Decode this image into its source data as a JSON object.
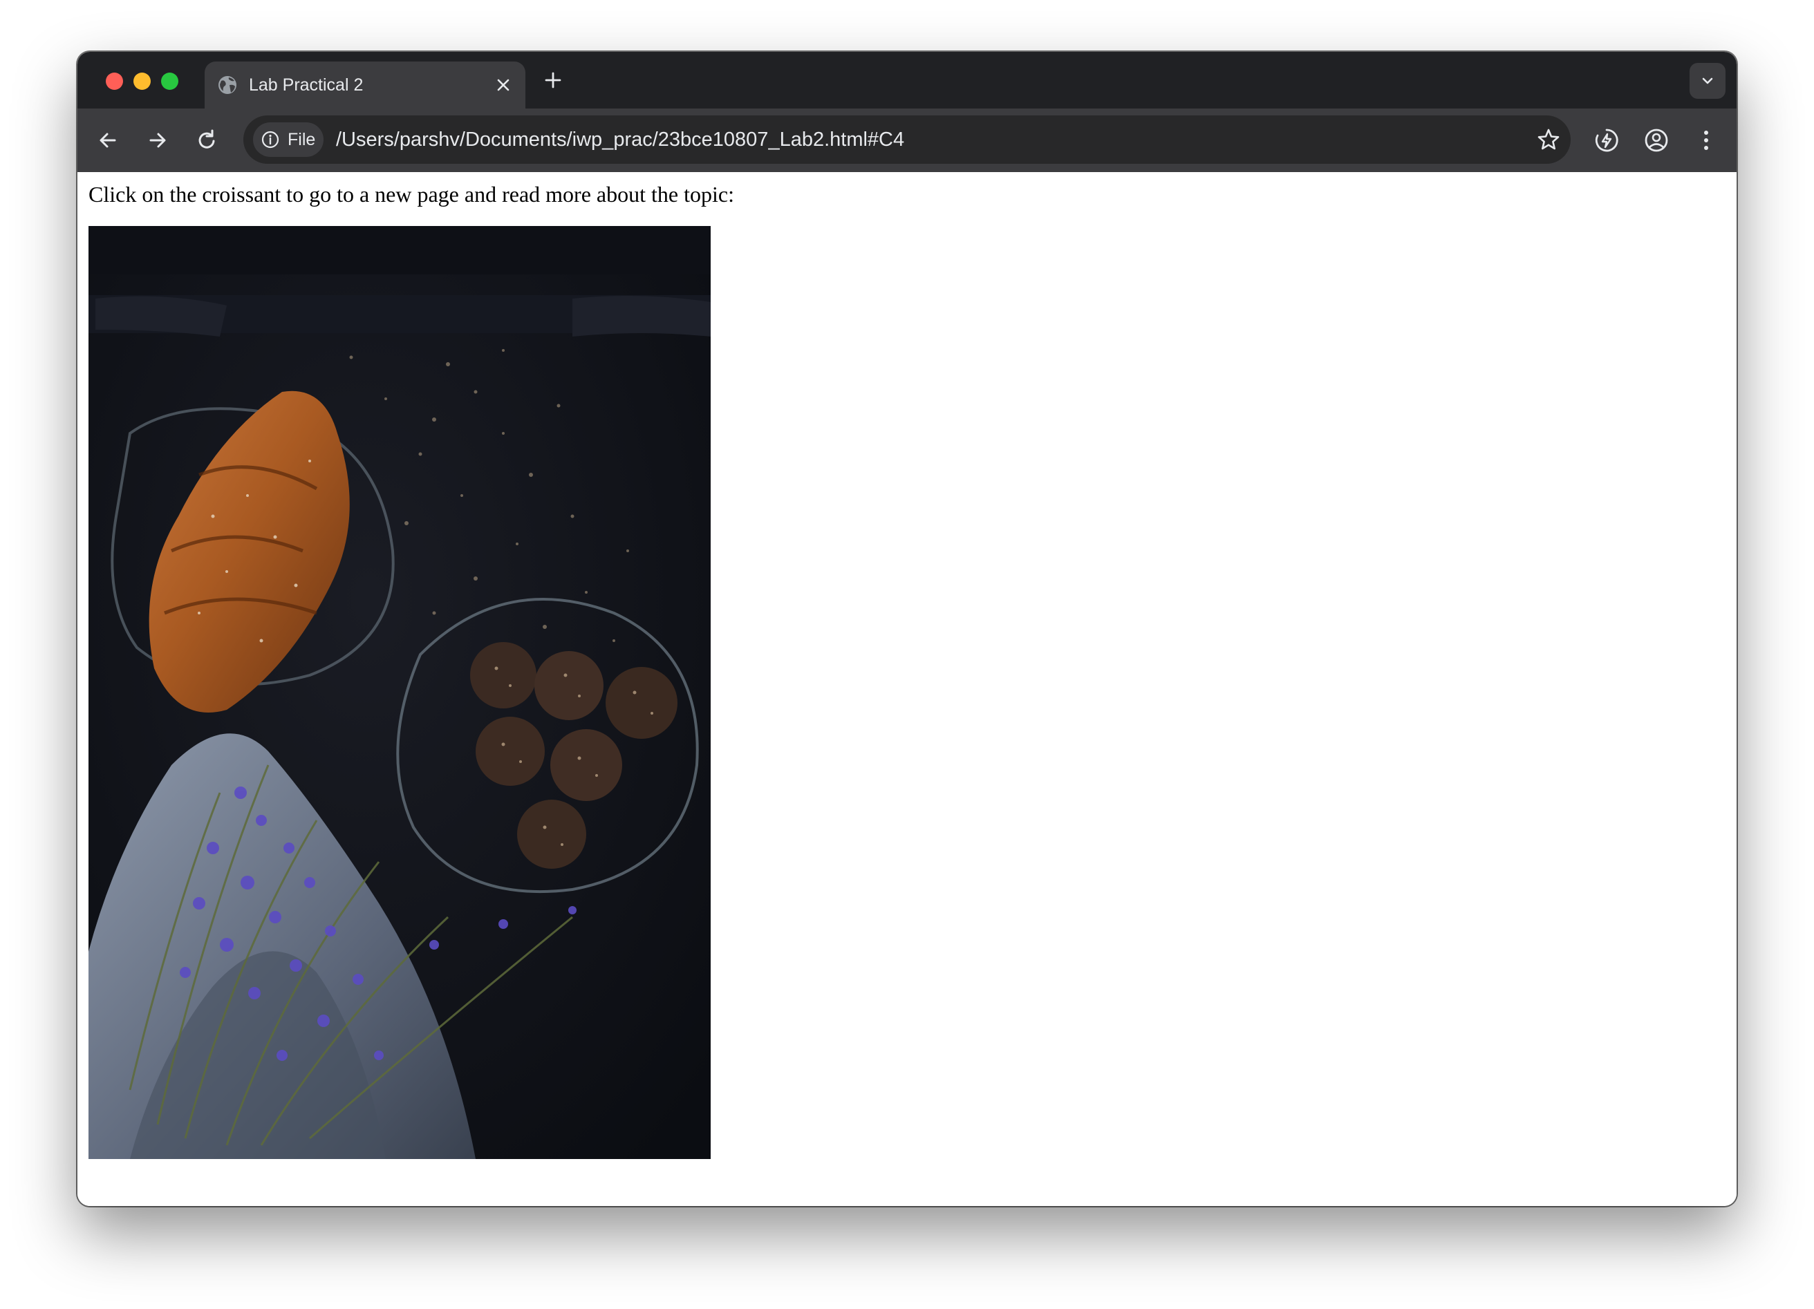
{
  "browser": {
    "tab": {
      "title": "Lab Practical 2",
      "favicon": "globe-icon"
    },
    "address_bar": {
      "chip_label": "File",
      "url": "/Users/parshv/Documents/iwp_prac/23bce10807_Lab2.html#C4"
    },
    "colors": {
      "tabstrip": "#202124",
      "toolbar": "#3c3c3f",
      "omnibox": "#282829",
      "traffic_red": "#ff5f57",
      "traffic_yellow": "#febc2e",
      "traffic_green": "#28c840"
    }
  },
  "page": {
    "intro_text": "Click on the croissant to go to a new page and read more about the topic:",
    "image": {
      "subject": "croissant"
    }
  }
}
